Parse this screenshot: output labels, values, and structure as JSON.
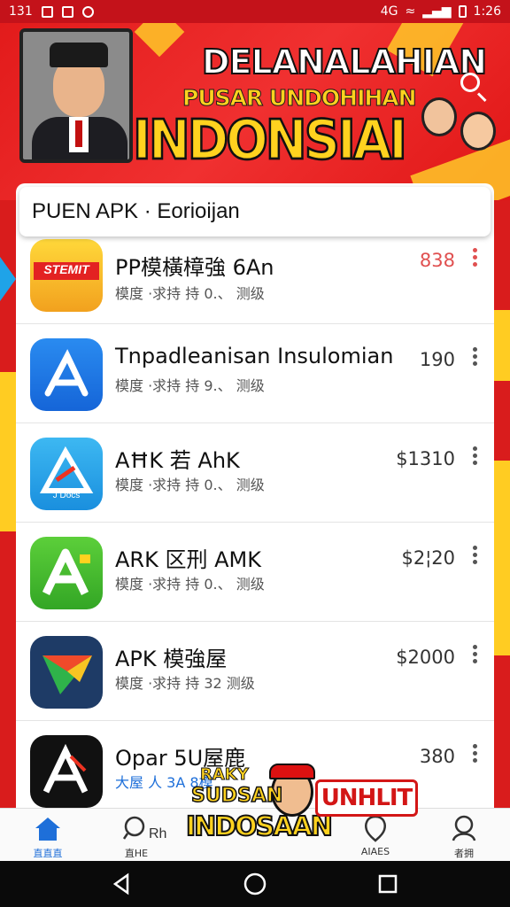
{
  "status_bar": {
    "left_text": "131",
    "time": "1:26",
    "signal_text": "4G"
  },
  "banner": {
    "title": "DELANALAHIAN",
    "subtitle": "PUSAR UNDOHIHAN",
    "big_title": "INDONSIAI"
  },
  "list_header": "PUEN APK · Eorioijan",
  "apps": [
    {
      "name": "PP模橫樟強 6An",
      "meta": "模度 ·求持 持 0.、 测级",
      "price": "838",
      "icon": "stemit-icon",
      "icon_text": "STEMIT"
    },
    {
      "name": "Tnpadleanisan Insulomian",
      "meta": "模度 ·求持 持 9.、 测级",
      "price": "190",
      "icon": "app-store-icon"
    },
    {
      "name": "AĦK 若 AhK",
      "meta": "模度 ·求持 持 0.、 测级",
      "price": "$1310",
      "icon": "paper-plane-icon",
      "icon_text": "J Docs"
    },
    {
      "name": "ARK 区刑 AMK",
      "meta": "模度 ·求持 持 0.、 测级",
      "price": "$2¦20",
      "icon": "green-a-icon"
    },
    {
      "name": "APK 模強屋",
      "meta": "模度 ·求持 持 32  测级",
      "price": "$2000",
      "icon": "play-triangle-icon"
    },
    {
      "name": "Opar 5U屋鹿",
      "meta": "大屋 人 3A 8模",
      "price": "380",
      "icon": "black-a-icon"
    }
  ],
  "overlay": {
    "badge_line1": "RAKY",
    "badge_line2": "SUDSAN",
    "badge_line3": "INDOSAAN",
    "sign_text": "UNHLIT"
  },
  "bottom_nav": [
    {
      "label": "直直直",
      "icon": "home-icon",
      "active": true
    },
    {
      "label": "直HE",
      "icon": "search-icon"
    },
    {
      "label": "Rh",
      "icon": "rh-text"
    },
    {
      "label": "AIAES",
      "icon": "shield-icon"
    },
    {
      "label": "者拥",
      "icon": "profile-icon"
    }
  ],
  "colors": {
    "banner_red": "#e21b1b",
    "accent_yellow": "#ffd21f",
    "nav_active": "#1e6fd9"
  }
}
